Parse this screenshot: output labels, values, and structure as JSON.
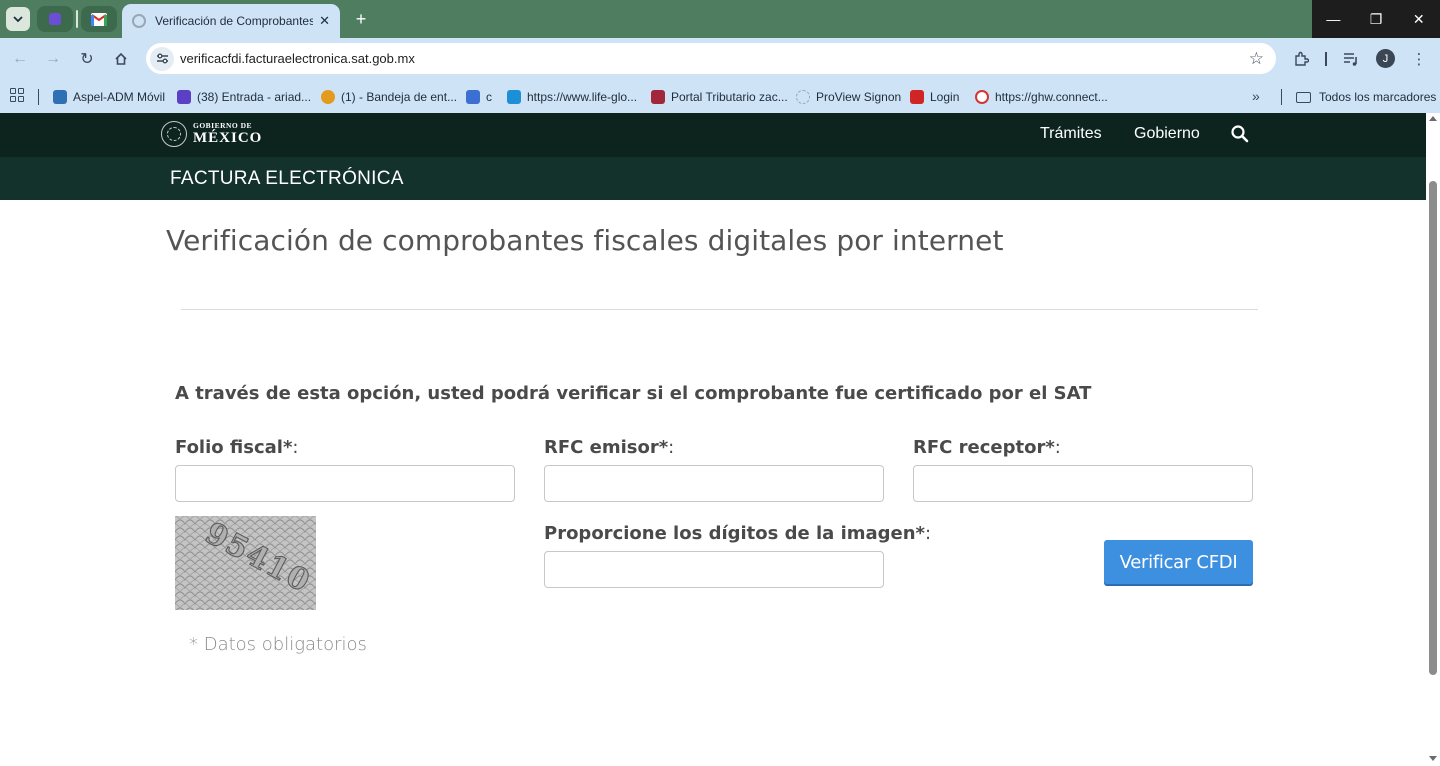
{
  "browser": {
    "tab_title": "Verificación de Comprobantes Fiscales",
    "url": "verificacfdi.facturaelectronica.sat.gob.mx",
    "profile_initial": "J",
    "bookmarks": [
      {
        "label": "Aspel-ADM Móvil",
        "icon_color": "#2f6fb3"
      },
      {
        "label": "(38) Entrada - ariad...",
        "icon_color": "#5b3fc4"
      },
      {
        "label": "(1) - Bandeja de ent...",
        "icon_color": "#e39a1d"
      },
      {
        "label": "c",
        "icon_color": "#3b6fd1"
      },
      {
        "label": "https://www.life-glo...",
        "icon_color": "#1d8fd6"
      },
      {
        "label": "Portal Tributario zac...",
        "icon_color": "#a3273a"
      },
      {
        "label": "ProView Signon",
        "icon_color": "#9aa6b2"
      },
      {
        "label": "Login",
        "icon_color": "#d12424"
      },
      {
        "label": "https://ghw.connect...",
        "icon_color": "#d43434"
      }
    ],
    "all_bookmarks_label": "Todos los marcadores"
  },
  "site": {
    "logo_small": "GOBIERNO DE",
    "logo_big": "MÉXICO",
    "nav": [
      "Trámites",
      "Gobierno"
    ],
    "section_title": "FACTURA ELECTRÓNICA"
  },
  "form": {
    "page_title": "Verificación de comprobantes fiscales digitales por internet",
    "subtitle": "A través de esta opción, usted podrá verificar si el comprobante fue certificado por el SAT",
    "folio_label": "Folio fiscal*",
    "rfc_emisor_label": "RFC emisor*",
    "rfc_receptor_label": "RFC receptor*",
    "captcha_label": "Proporcione los dígitos de la imagen*",
    "colon": ":",
    "folio_value": "",
    "rfc_emisor_value": "",
    "rfc_receptor_value": "",
    "captcha_value": "",
    "captcha_image_text": "95410",
    "verify_button": "Verificar CFDI",
    "required_note": "* Datos obligatorios"
  },
  "colors": {
    "gob_header": "#0c231e",
    "section_bar": "#13322b",
    "button_blue": "#3d8fe0",
    "browser_frame": "#4f7d5f"
  }
}
